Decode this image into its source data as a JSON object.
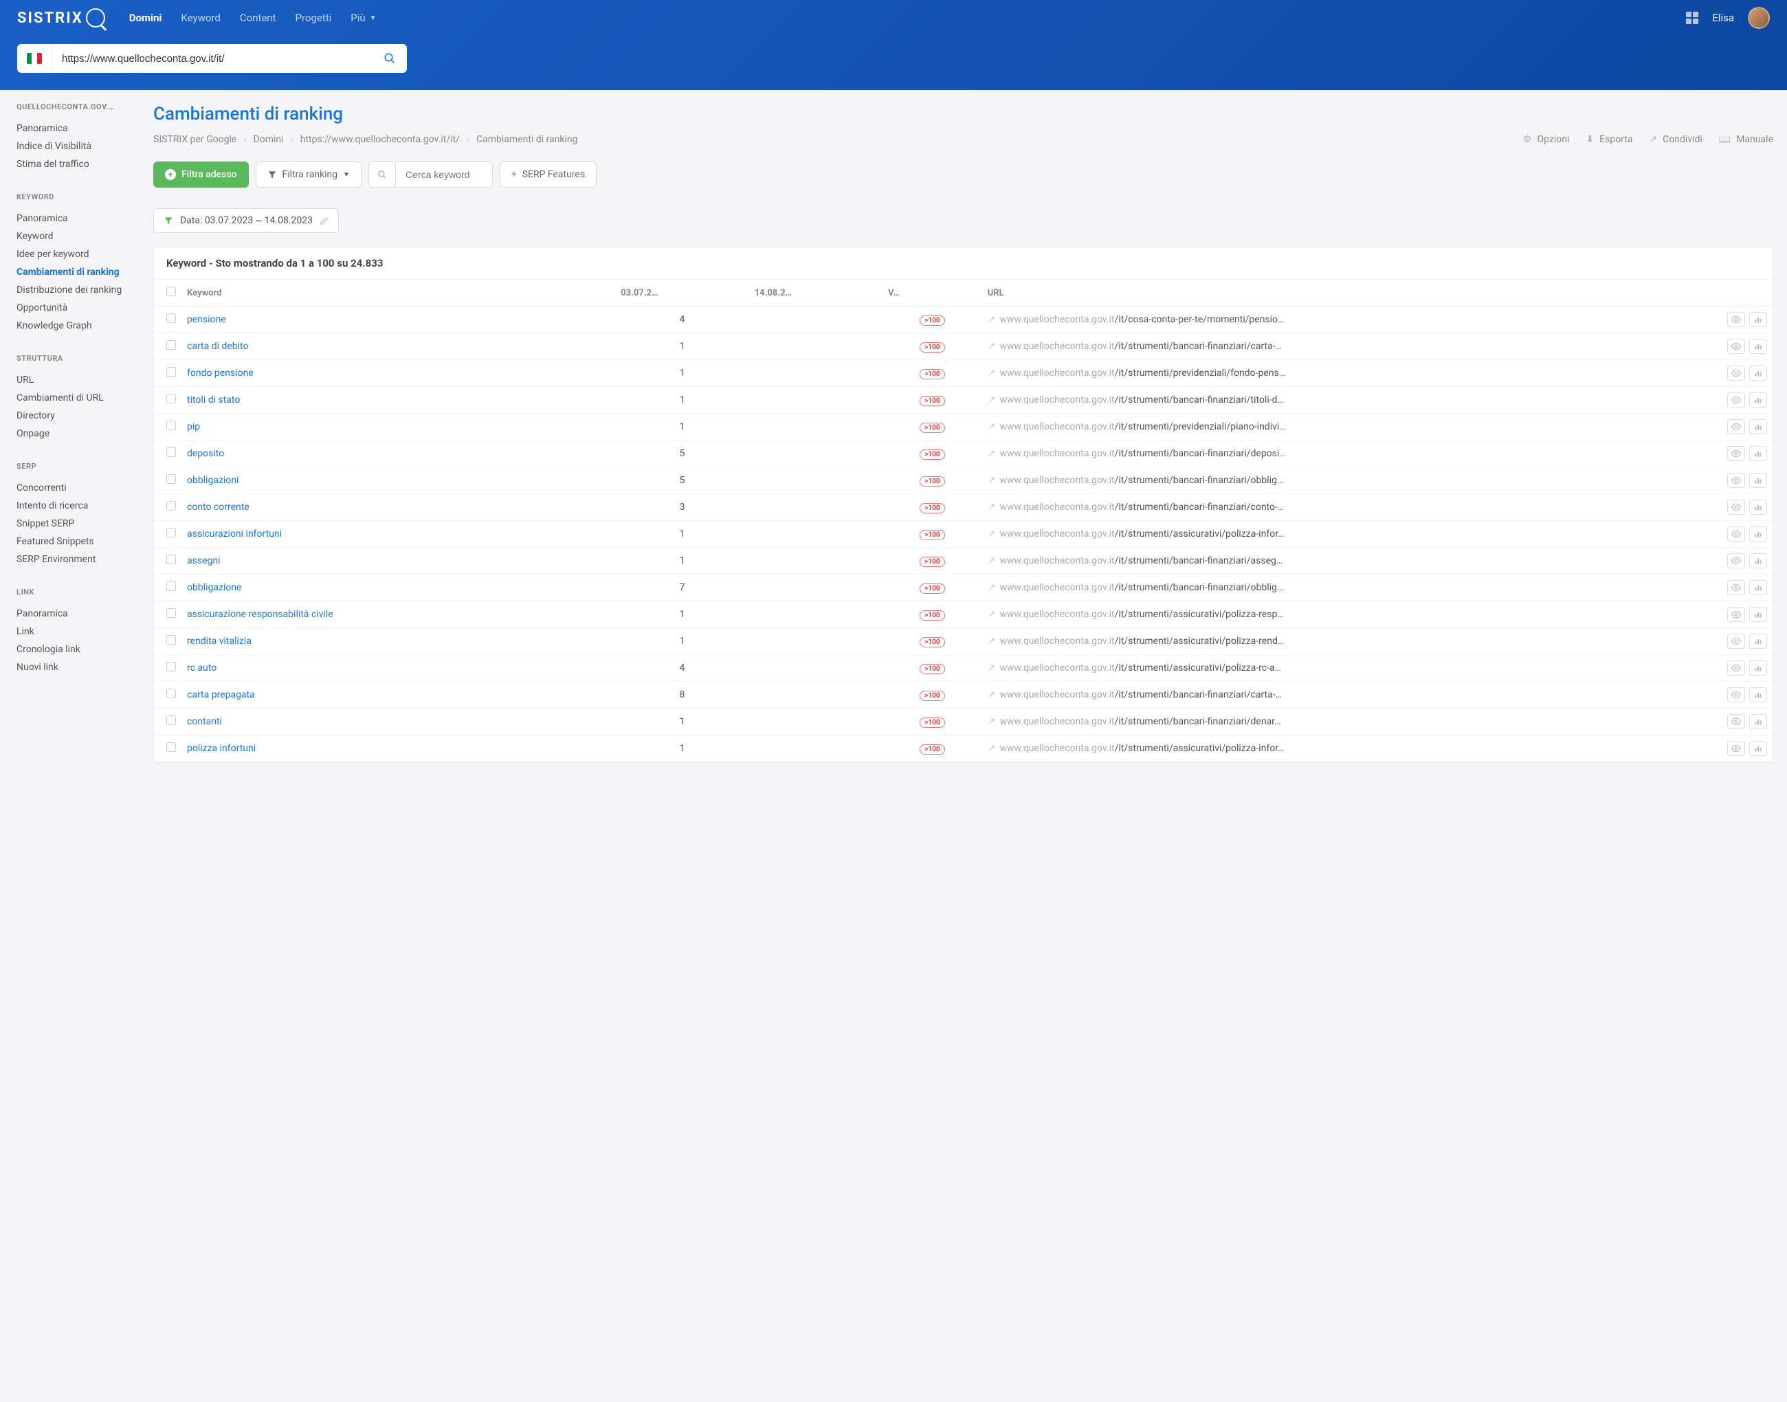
{
  "header": {
    "logo": "SISTRIX",
    "nav": [
      "Domini",
      "Keyword",
      "Content",
      "Progetti",
      "Più"
    ],
    "nav_active": 0,
    "user": "Elisa",
    "search_value": "https://www.quellocheconta.gov.it/it/"
  },
  "sidebar": {
    "sections": [
      {
        "header": "QUELLOCHECONTA.GOV.…",
        "items": [
          "Panoramica",
          "Indice di Visibilità",
          "Stima del traffico"
        ]
      },
      {
        "header": "KEYWORD",
        "items": [
          "Panoramica",
          "Keyword",
          "Idee per keyword",
          "Cambiamenti di ranking",
          "Distribuzione dei ranking",
          "Opportunità",
          "Knowledge Graph"
        ],
        "active_index": 3
      },
      {
        "header": "STRUTTURA",
        "items": [
          "URL",
          "Cambiamenti di URL",
          "Directory",
          "Onpage"
        ]
      },
      {
        "header": "SERP",
        "items": [
          "Concorrenti",
          "Intento di ricerca",
          "Snippet SERP",
          "Featured Snippets",
          "SERP Environment"
        ]
      },
      {
        "header": "LINK",
        "items": [
          "Panoramica",
          "Link",
          "Cronologia link",
          "Nuovi link"
        ]
      }
    ]
  },
  "page": {
    "title": "Cambiamenti di ranking",
    "breadcrumbs": [
      "SISTRIX per Google",
      "Domini",
      "https://www.quellocheconta.gov.it/it/",
      "Cambiamenti di ranking"
    ],
    "actions": [
      "Opzioni",
      "Esporta",
      "Condividi",
      "Manuale"
    ],
    "filters": {
      "primary": "Filtra adesso",
      "ranking": "Filtra ranking",
      "search_placeholder": "Cerca keyword",
      "serp": "SERP Features"
    },
    "date_filter": "Data: 03.07.2023 ~ 14.08.2023",
    "table": {
      "title": "Keyword - Sto mostrando da 1 a 100 su 24.833",
      "columns": [
        "Keyword",
        "03.07.2…",
        "14.08.2…",
        "V…",
        "URL"
      ],
      "url_prefix": "www.quellocheconta.gov.it",
      "pill": ">100",
      "rows": [
        {
          "kw": "pensione",
          "d1": "4",
          "d2": "",
          "path": "/it/cosa-conta-per-te/momenti/pensio…"
        },
        {
          "kw": "carta di debito",
          "d1": "1",
          "d2": "",
          "path": "/it/strumenti/bancari-finanziari/carta-…"
        },
        {
          "kw": "fondo pensione",
          "d1": "1",
          "d2": "",
          "path": "/it/strumenti/previdenziali/fondo-pens…"
        },
        {
          "kw": "titoli di stato",
          "d1": "1",
          "d2": "",
          "path": "/it/strumenti/bancari-finanziari/titoli-d…"
        },
        {
          "kw": "pip",
          "d1": "1",
          "d2": "",
          "path": "/it/strumenti/previdenziali/piano-indivi…"
        },
        {
          "kw": "deposito",
          "d1": "5",
          "d2": "",
          "path": "/it/strumenti/bancari-finanziari/deposi…"
        },
        {
          "kw": "obbligazioni",
          "d1": "5",
          "d2": "",
          "path": "/it/strumenti/bancari-finanziari/obblig…"
        },
        {
          "kw": "conto corrente",
          "d1": "3",
          "d2": "",
          "path": "/it/strumenti/bancari-finanziari/conto-…"
        },
        {
          "kw": "assicurazioni infortuni",
          "d1": "1",
          "d2": "",
          "path": "/it/strumenti/assicurativi/polizza-infor…"
        },
        {
          "kw": "assegni",
          "d1": "1",
          "d2": "",
          "path": "/it/strumenti/bancari-finanziari/asseg…"
        },
        {
          "kw": "obbligazione",
          "d1": "7",
          "d2": "",
          "path": "/it/strumenti/bancari-finanziari/obblig…"
        },
        {
          "kw": "assicurazione responsabilità civile",
          "d1": "1",
          "d2": "",
          "path": "/it/strumenti/assicurativi/polizza-resp…"
        },
        {
          "kw": "rendita vitalizia",
          "d1": "1",
          "d2": "",
          "path": "/it/strumenti/assicurativi/polizza-rend…"
        },
        {
          "kw": "rc auto",
          "d1": "4",
          "d2": "",
          "path": "/it/strumenti/assicurativi/polizza-rc-a…"
        },
        {
          "kw": "carta prepagata",
          "d1": "8",
          "d2": "",
          "path": "/it/strumenti/bancari-finanziari/carta-…"
        },
        {
          "kw": "contanti",
          "d1": "1",
          "d2": "",
          "path": "/it/strumenti/bancari-finanziari/denar…"
        },
        {
          "kw": "polizza infortuni",
          "d1": "1",
          "d2": "",
          "path": "/it/strumenti/assicurativi/polizza-infor…"
        }
      ]
    }
  }
}
